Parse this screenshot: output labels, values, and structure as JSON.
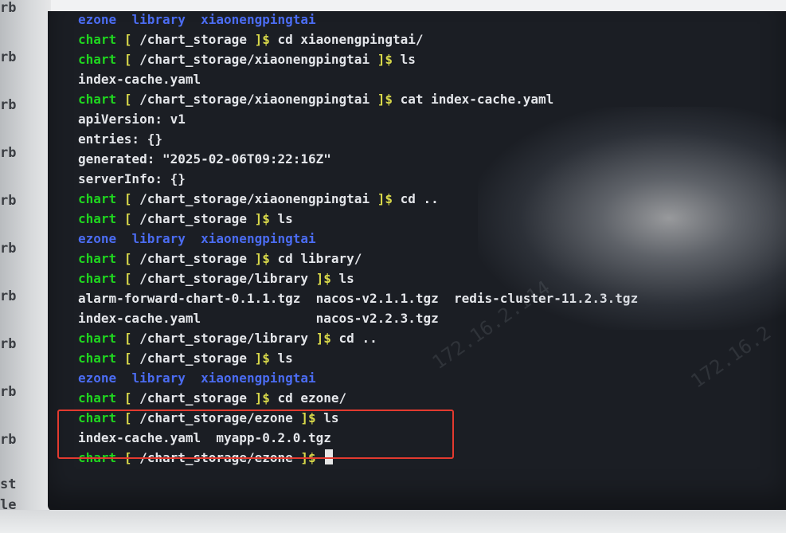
{
  "background": {
    "left_fragments": [
      "rb",
      "rb",
      "rb",
      "rb",
      "rb",
      "rb",
      "rb",
      "rb",
      "rb",
      "rb",
      "st",
      "le"
    ],
    "accent_colors": {
      "prompt_user": "#1fd51f",
      "prompt_bracket": "#d9d94a",
      "directory": "#4b6cf2",
      "highlight_box": "#e33a2f"
    }
  },
  "terminal": {
    "lines": [
      {
        "type": "dirs",
        "items": [
          "ezone",
          "library",
          "xiaonengpingtai"
        ]
      },
      {
        "type": "prompt",
        "user": "chart",
        "open": "[",
        "path": " /chart_storage ",
        "close": "]$",
        "cmd": " cd xiaonengpingtai/"
      },
      {
        "type": "prompt",
        "user": "chart",
        "open": "[",
        "path": " /chart_storage/xiaonengpingtai ",
        "close": "]$",
        "cmd": " ls"
      },
      {
        "type": "output",
        "text": "index-cache.yaml"
      },
      {
        "type": "prompt",
        "user": "chart",
        "open": "[",
        "path": " /chart_storage/xiaonengpingtai ",
        "close": "]$",
        "cmd": " cat index-cache.yaml"
      },
      {
        "type": "output",
        "text": "apiVersion: v1"
      },
      {
        "type": "output",
        "text": "entries: {}"
      },
      {
        "type": "output",
        "text": "generated: \"2025-02-06T09:22:16Z\""
      },
      {
        "type": "output",
        "text": "serverInfo: {}"
      },
      {
        "type": "prompt",
        "user": "chart",
        "open": "[",
        "path": " /chart_storage/xiaonengpingtai ",
        "close": "]$",
        "cmd": " cd .."
      },
      {
        "type": "prompt",
        "user": "chart",
        "open": "[",
        "path": " /chart_storage ",
        "close": "]$",
        "cmd": " ls"
      },
      {
        "type": "dirs",
        "items": [
          "ezone",
          "library",
          "xiaonengpingtai"
        ]
      },
      {
        "type": "prompt",
        "user": "chart",
        "open": "[",
        "path": " /chart_storage ",
        "close": "]$",
        "cmd": " cd library/"
      },
      {
        "type": "prompt",
        "user": "chart",
        "open": "[",
        "path": " /chart_storage/library ",
        "close": "]$",
        "cmd": " ls"
      },
      {
        "type": "output",
        "text": "alarm-forward-chart-0.1.1.tgz  nacos-v2.1.1.tgz  redis-cluster-11.2.3.tgz"
      },
      {
        "type": "output",
        "text": "index-cache.yaml               nacos-v2.2.3.tgz"
      },
      {
        "type": "prompt",
        "user": "chart",
        "open": "[",
        "path": " /chart_storage/library ",
        "close": "]$",
        "cmd": " cd .."
      },
      {
        "type": "prompt",
        "user": "chart",
        "open": "[",
        "path": " /chart_storage ",
        "close": "]$",
        "cmd": " ls"
      },
      {
        "type": "dirs",
        "items": [
          "ezone",
          "library",
          "xiaonengpingtai"
        ]
      },
      {
        "type": "prompt",
        "user": "chart",
        "open": "[",
        "path": " /chart_storage ",
        "close": "]$",
        "cmd": " cd ezone/"
      },
      {
        "type": "prompt",
        "user": "chart",
        "open": "[",
        "path": " /chart_storage/ezone ",
        "close": "]$",
        "cmd": " ls"
      },
      {
        "type": "output",
        "text": "index-cache.yaml  myapp-0.2.0.tgz"
      },
      {
        "type": "prompt",
        "user": "chart",
        "open": "[",
        "path": " /chart_storage/ezone ",
        "close": "]$",
        "cmd": " ",
        "cursor": true
      }
    ]
  }
}
